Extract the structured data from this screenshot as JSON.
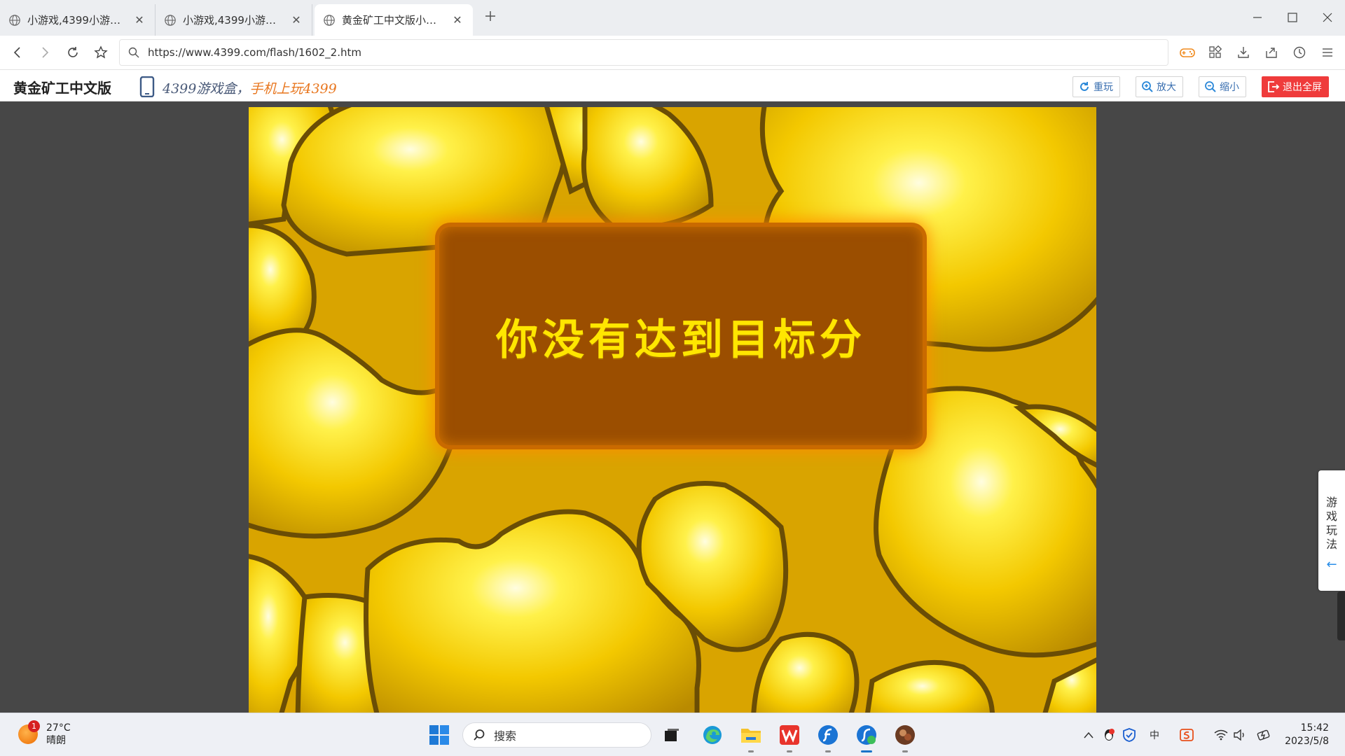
{
  "tabs": [
    {
      "title": "小游戏,4399小游戏,..."
    },
    {
      "title": "小游戏,4399小游戏..."
    },
    {
      "title": "黄金矿工中文版小游..."
    }
  ],
  "address": {
    "url": "https://www.4399.com/flash/1602_2.htm"
  },
  "gamebar": {
    "title": "黄金矿工中文版",
    "promo_part1": "4399游戏盒，",
    "promo_part2": "手机上玩4399",
    "buttons": {
      "replay": "重玩",
      "zoom_in": "放大",
      "zoom_out": "缩小",
      "exit_fullscreen": "退出全屏"
    }
  },
  "game": {
    "message": "你没有达到目标分"
  },
  "side_tab": {
    "chars": [
      "游",
      "戏",
      "玩",
      "法"
    ],
    "arrow": "←"
  },
  "taskbar": {
    "weather": {
      "badge": "1",
      "temp": "27°C",
      "condition": "晴朗"
    },
    "search_placeholder": "搜索",
    "ime": "中",
    "time": "15:42",
    "date": "2023/5/8"
  },
  "colors": {
    "exit_button": "#ef3b3b",
    "panel": "#9b4e00",
    "message": "#ffe600",
    "content_bg": "#474747",
    "accent": "#1a73c8"
  }
}
